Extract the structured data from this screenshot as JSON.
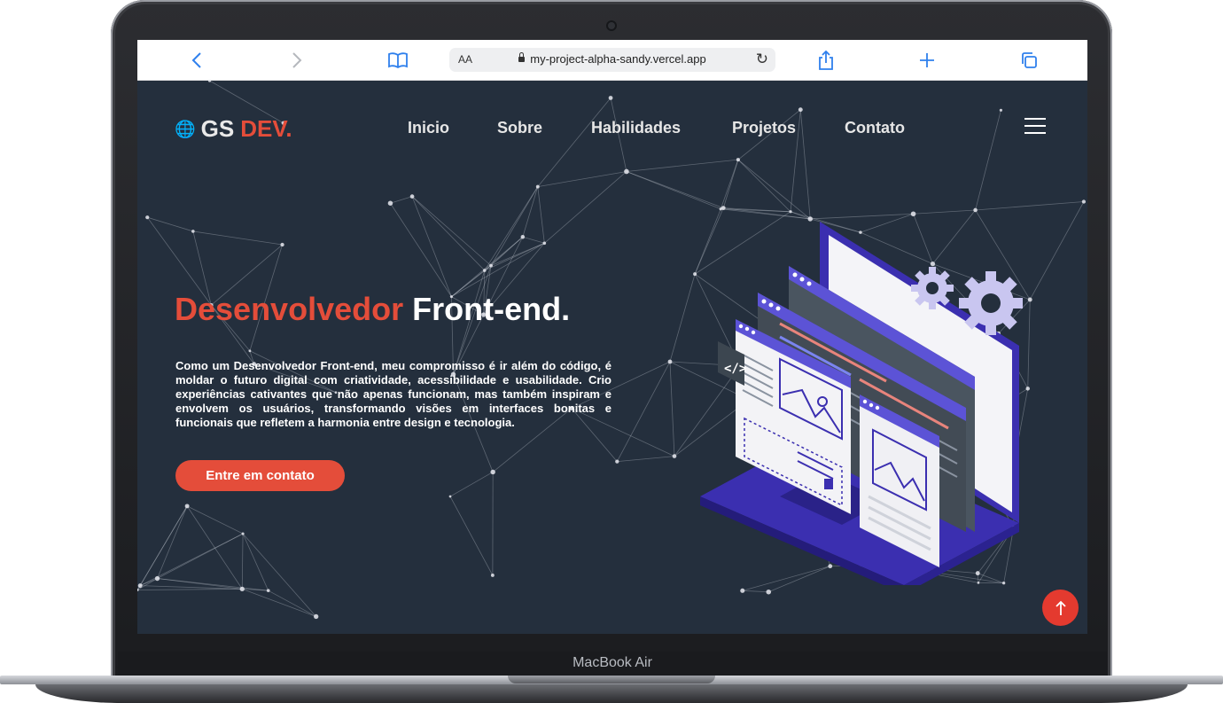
{
  "device": {
    "label": "MacBook Air"
  },
  "browser": {
    "url": "my-project-alpha-sandy.vercel.app",
    "text_size_label": "AA"
  },
  "site": {
    "logo_main": "GS",
    "logo_accent": "DEV.",
    "nav": [
      "Inicio",
      "Sobre",
      "Habilidades",
      "Projetos",
      "Contato"
    ]
  },
  "hero": {
    "title_accent": "Desenvolvedor",
    "title_main": "Front-end.",
    "description": "Como um Desenvolvedor Front-end, meu compromisso é ir além do código, é moldar o futuro digital com criatividade, acessibilidade e usabilidade. Crio experiências cativantes que não apenas funcionam, mas também inspiram e envolvem os usuários, transformando visões em interfaces bonitas e funcionais que refletem a harmonia entre design e tecnologia.",
    "cta_label": "Entre em contato"
  },
  "colors": {
    "background": "#242f3d",
    "accent": "#e44d3a",
    "illustration_primary": "#3b2fb0",
    "illustration_secondary": "#5c53d6"
  },
  "icons": {
    "back": "chevron-left-icon",
    "forward": "chevron-right-icon",
    "bookmarks": "book-icon",
    "lock": "lock-icon",
    "reload": "reload-icon",
    "share": "share-icon",
    "new_tab": "plus-icon",
    "tabs": "tabs-icon",
    "globe": "globe-icon",
    "menu": "hamburger-icon",
    "scroll_top": "arrow-up-icon"
  }
}
